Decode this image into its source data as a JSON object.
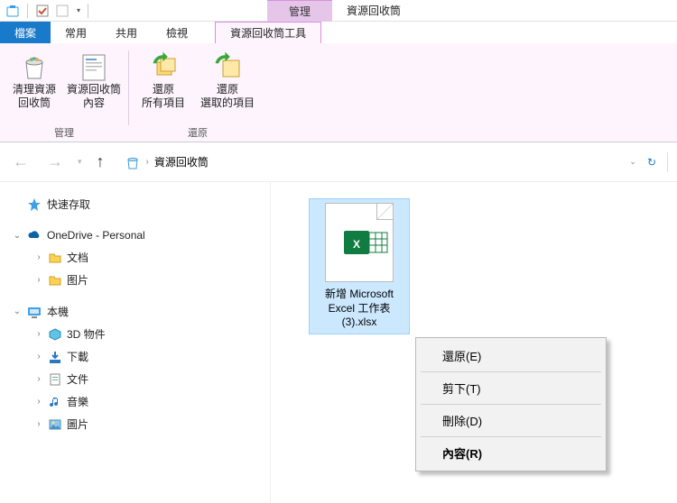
{
  "qat": {
    "dropdown_glyph": "▾"
  },
  "title": {
    "context_group": "管理",
    "window": "資源回收筒"
  },
  "tabs": {
    "file": "檔案",
    "home": "常用",
    "share": "共用",
    "view": "檢視",
    "context": "資源回收筒工具"
  },
  "ribbon": {
    "manage_group": "管理",
    "restore_group": "還原",
    "empty_bin": "清理資源\n回收筒",
    "bin_properties": "資源回收筒\n內容",
    "restore_all": "還原\n所有項目",
    "restore_selected": "還原\n選取的項目"
  },
  "nav": {
    "refresh_glyph": "↻",
    "breadcrumb": "資源回收筒",
    "sep": "›"
  },
  "tree": {
    "quick_access": "快速存取",
    "onedrive": "OneDrive - Personal",
    "onedrive_docs": "文档",
    "onedrive_pics": "图片",
    "this_pc": "本機",
    "pc_3d": "3D 物件",
    "pc_downloads": "下載",
    "pc_documents": "文件",
    "pc_music": "音樂",
    "pc_pictures": "圖片"
  },
  "file": {
    "name": "新增 Microsoft Excel 工作表 (3).xlsx"
  },
  "ctx_menu": {
    "restore": "還原(E)",
    "cut": "剪下(T)",
    "delete": "刪除(D)",
    "properties": "內容(R)"
  }
}
